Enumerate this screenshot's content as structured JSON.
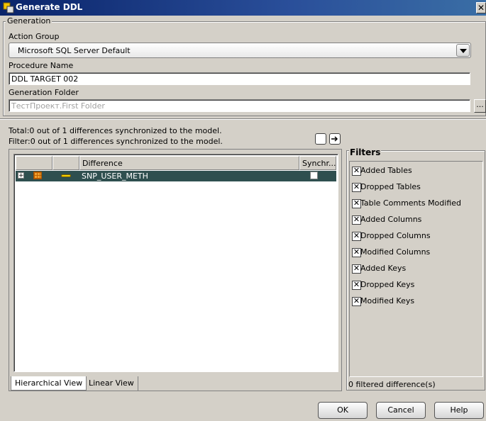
{
  "window": {
    "title": "Generate DDL"
  },
  "generation": {
    "legend": "Generation",
    "action_group_label": "Action Group",
    "action_group_value": "Microsoft SQL Server Default",
    "procedure_name_label": "Procedure Name",
    "procedure_name_value": "DDL TARGET 002",
    "generation_folder_label": "Generation Folder",
    "generation_folder_value": "ТестПроект.First Folder"
  },
  "status": {
    "total": "Total:0 out of 1 differences synchronized to the model.",
    "filter": "Filter:0 out of 1 differences synchronized to the model."
  },
  "table": {
    "columns": [
      "",
      "",
      "Difference",
      "Synchr..."
    ],
    "rows": [
      {
        "difference": "SNP_USER_METH",
        "synchronized": false
      }
    ]
  },
  "tabs": [
    "Hierarchical View",
    "Linear View"
  ],
  "filters": {
    "title": "Filters",
    "items": [
      {
        "label": "Added Tables",
        "checked": true
      },
      {
        "label": "Dropped Tables",
        "checked": true
      },
      {
        "label": "Table Comments Modified",
        "checked": true
      },
      {
        "label": "Added Columns",
        "checked": true
      },
      {
        "label": "Dropped Columns",
        "checked": true
      },
      {
        "label": "Modified Columns",
        "checked": true
      },
      {
        "label": "Added Keys",
        "checked": true
      },
      {
        "label": "Dropped Keys",
        "checked": true
      },
      {
        "label": "Modified Keys",
        "checked": true
      }
    ],
    "count_text": "0 filtered difference(s)"
  },
  "buttons": {
    "ok": "OK",
    "cancel": "Cancel",
    "help": "Help",
    "browse": "..."
  },
  "colors": {
    "title_bar": "#0a246a",
    "selected_row": "#2f4f4f",
    "dialog_bg": "#d4d0c8"
  }
}
